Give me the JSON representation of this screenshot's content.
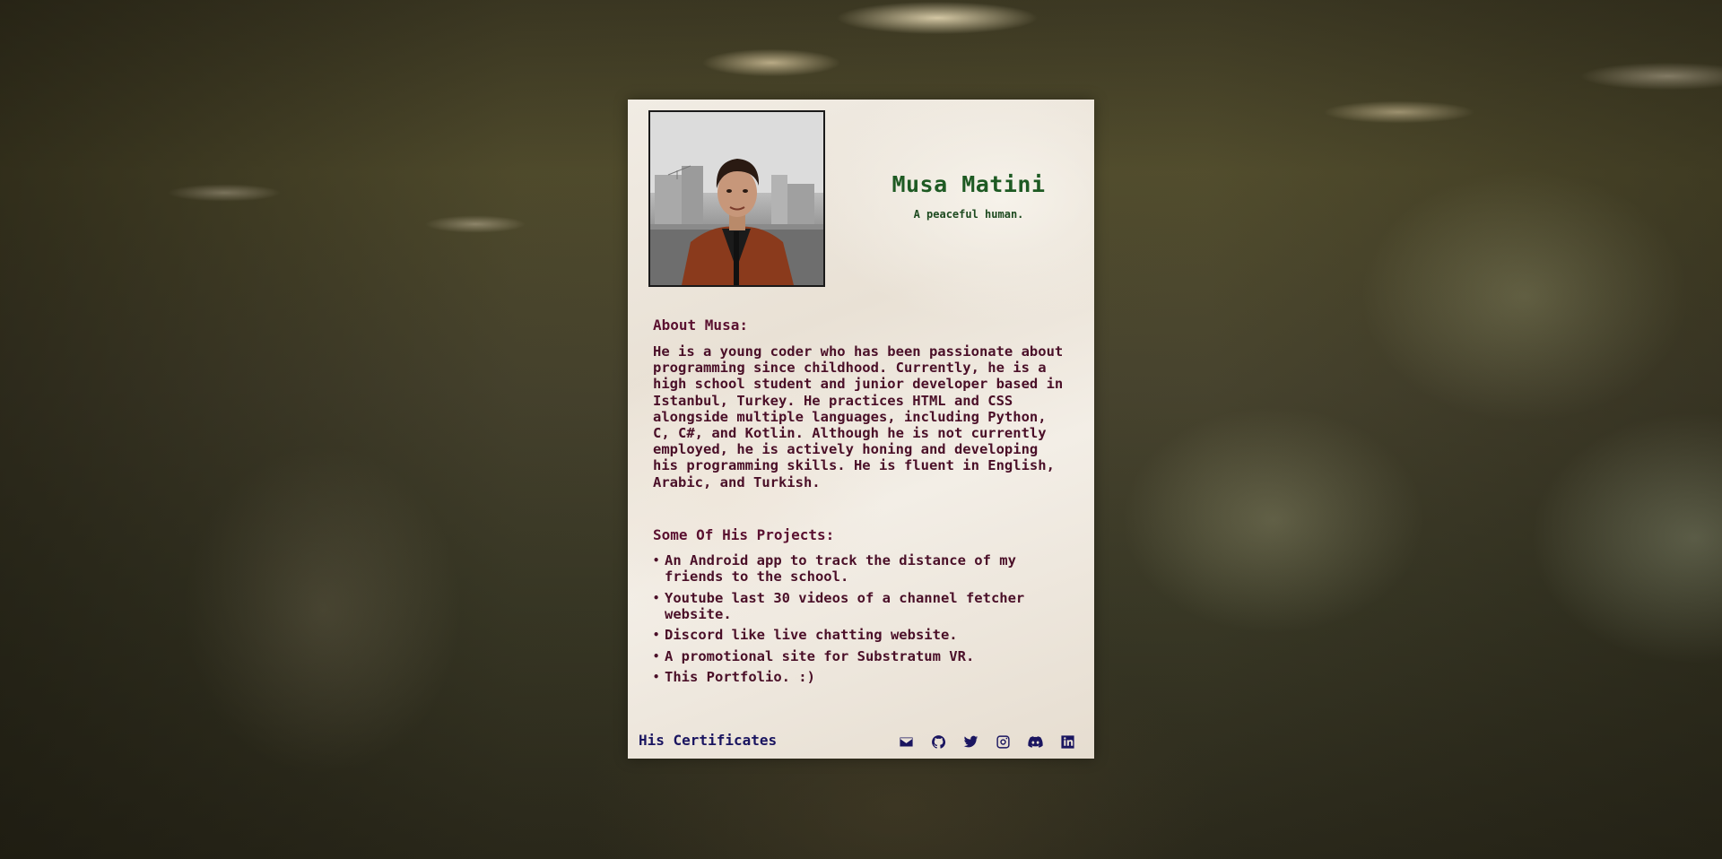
{
  "profile": {
    "name": "Musa Matini",
    "tagline": "A peaceful human."
  },
  "about": {
    "title": "About Musa:",
    "text": "He is a young coder who has been passionate about programming since childhood. Currently, he is a high school student and junior developer based in Istanbul, Turkey. He practices HTML and CSS alongside multiple languages, including Python, C, C#, and Kotlin. Although he is not currently employed, he is actively honing and developing his programming skills. He is fluent in English, Arabic, and Turkish."
  },
  "projects": {
    "title": "Some Of His Projects:",
    "items": [
      "An Android app to track the distance of my friends to the school.",
      "Youtube last 30 videos of a channel fetcher website.",
      "Discord like live chatting website.",
      "A promotional site for Substratum VR.",
      "This Portfolio. :)"
    ]
  },
  "footer": {
    "certificates_label": "His Certificates",
    "socials": [
      "envelope-icon",
      "github-icon",
      "twitter-icon",
      "instagram-icon",
      "discord-icon",
      "linkedin-icon"
    ]
  },
  "colors": {
    "name": "#1e5a23",
    "heading": "#5a1030",
    "body_text": "#4a0f28",
    "link": "#1a1560"
  }
}
